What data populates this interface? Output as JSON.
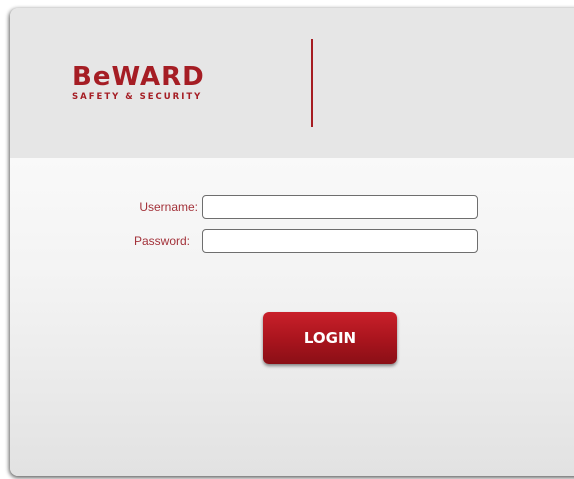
{
  "brand": {
    "name": "BeWARD",
    "tagline": "SAFETY & SECURITY",
    "color": "#a51d24"
  },
  "form": {
    "username_label": "Username:",
    "username_value": "",
    "password_label": "Password:",
    "password_value": "",
    "login_label": "LOGIN"
  }
}
